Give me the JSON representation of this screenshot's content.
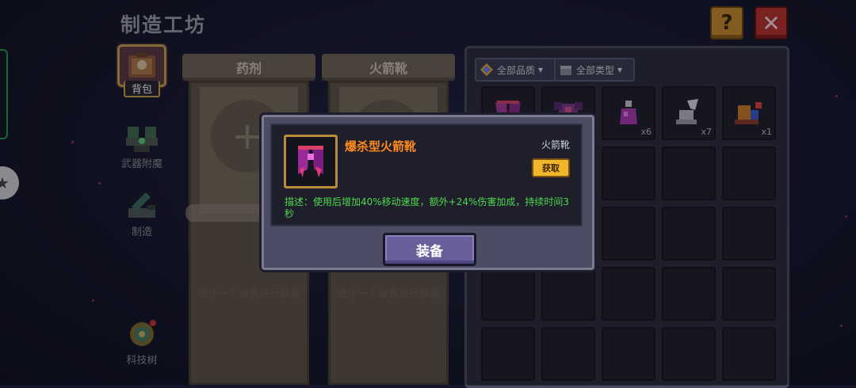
{
  "header": {
    "title": "制造工坊",
    "help_label": "?",
    "close_label": "✕"
  },
  "nav": [
    {
      "label": "背包",
      "icon": "backpack-icon",
      "active": true
    },
    {
      "label": "武器附魔",
      "icon": "enchant-anvil-icon",
      "active": false
    },
    {
      "label": "制造",
      "icon": "crafting-icon",
      "active": false
    },
    {
      "label": "科技树",
      "icon": "tech-tree-icon",
      "active": false
    }
  ],
  "slots": [
    {
      "title": "药剂",
      "hint": "选择一个道具进行装备"
    },
    {
      "title": "火箭靴",
      "hint": "选择一个道具进行装备"
    }
  ],
  "inventory": {
    "filters": [
      {
        "label": "全部品质"
      },
      {
        "label": "全部类型"
      }
    ],
    "items": [
      {
        "icon": "rocket-boots-icon",
        "count": ""
      },
      {
        "icon": "armor-icon",
        "count": ""
      },
      {
        "icon": "potion-icon",
        "count": "x6"
      },
      {
        "icon": "wing-boots-icon",
        "count": "x7"
      },
      {
        "icon": "jet-boots-icon",
        "count": "x1"
      }
    ]
  },
  "modal": {
    "item_name": "爆杀型火箭靴",
    "item_type": "火箭靴",
    "get_label": "获取",
    "description": "描述：使用后增加40%移动速度，额外+24%伤害加成，持续时间3秒",
    "equip_label": "装备"
  },
  "colors": {
    "accent_orange": "#ff8a1e",
    "desc_green": "#4fd84f",
    "equip_purple": "#6a5f9a"
  }
}
